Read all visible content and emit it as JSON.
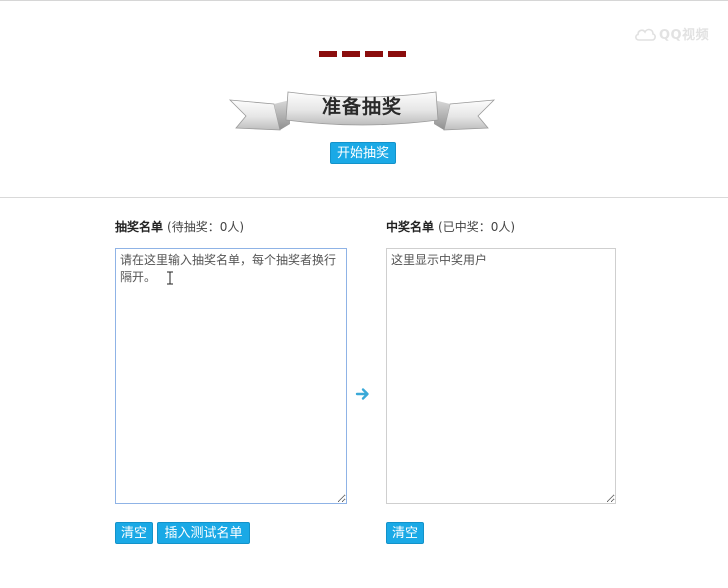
{
  "watermark": {
    "text": "QQ视频",
    "icon": "qq-cloud-icon"
  },
  "banner": {
    "title": "准备抽奖",
    "decoration_color": "#8b0d0d"
  },
  "start_button": {
    "label": "开始抽奖"
  },
  "left_panel": {
    "title": "抽奖名单",
    "count_text": "(待抽奖：0人)",
    "placeholder": "请在这里输入抽奖名单，每个抽奖者换行隔开。",
    "value": "",
    "clear_label": "清空",
    "insert_label": "插入测试名单"
  },
  "transfer_icon": "arrow-right-icon",
  "right_panel": {
    "title": "中奖名单",
    "count_text": "(已中奖：0人)",
    "placeholder": "这里显示中奖用户",
    "value": "",
    "clear_label": "清空"
  },
  "colors": {
    "button": "#1aa9e6",
    "arrow": "#3aa9d8",
    "focus_border": "#8fb3e6"
  }
}
